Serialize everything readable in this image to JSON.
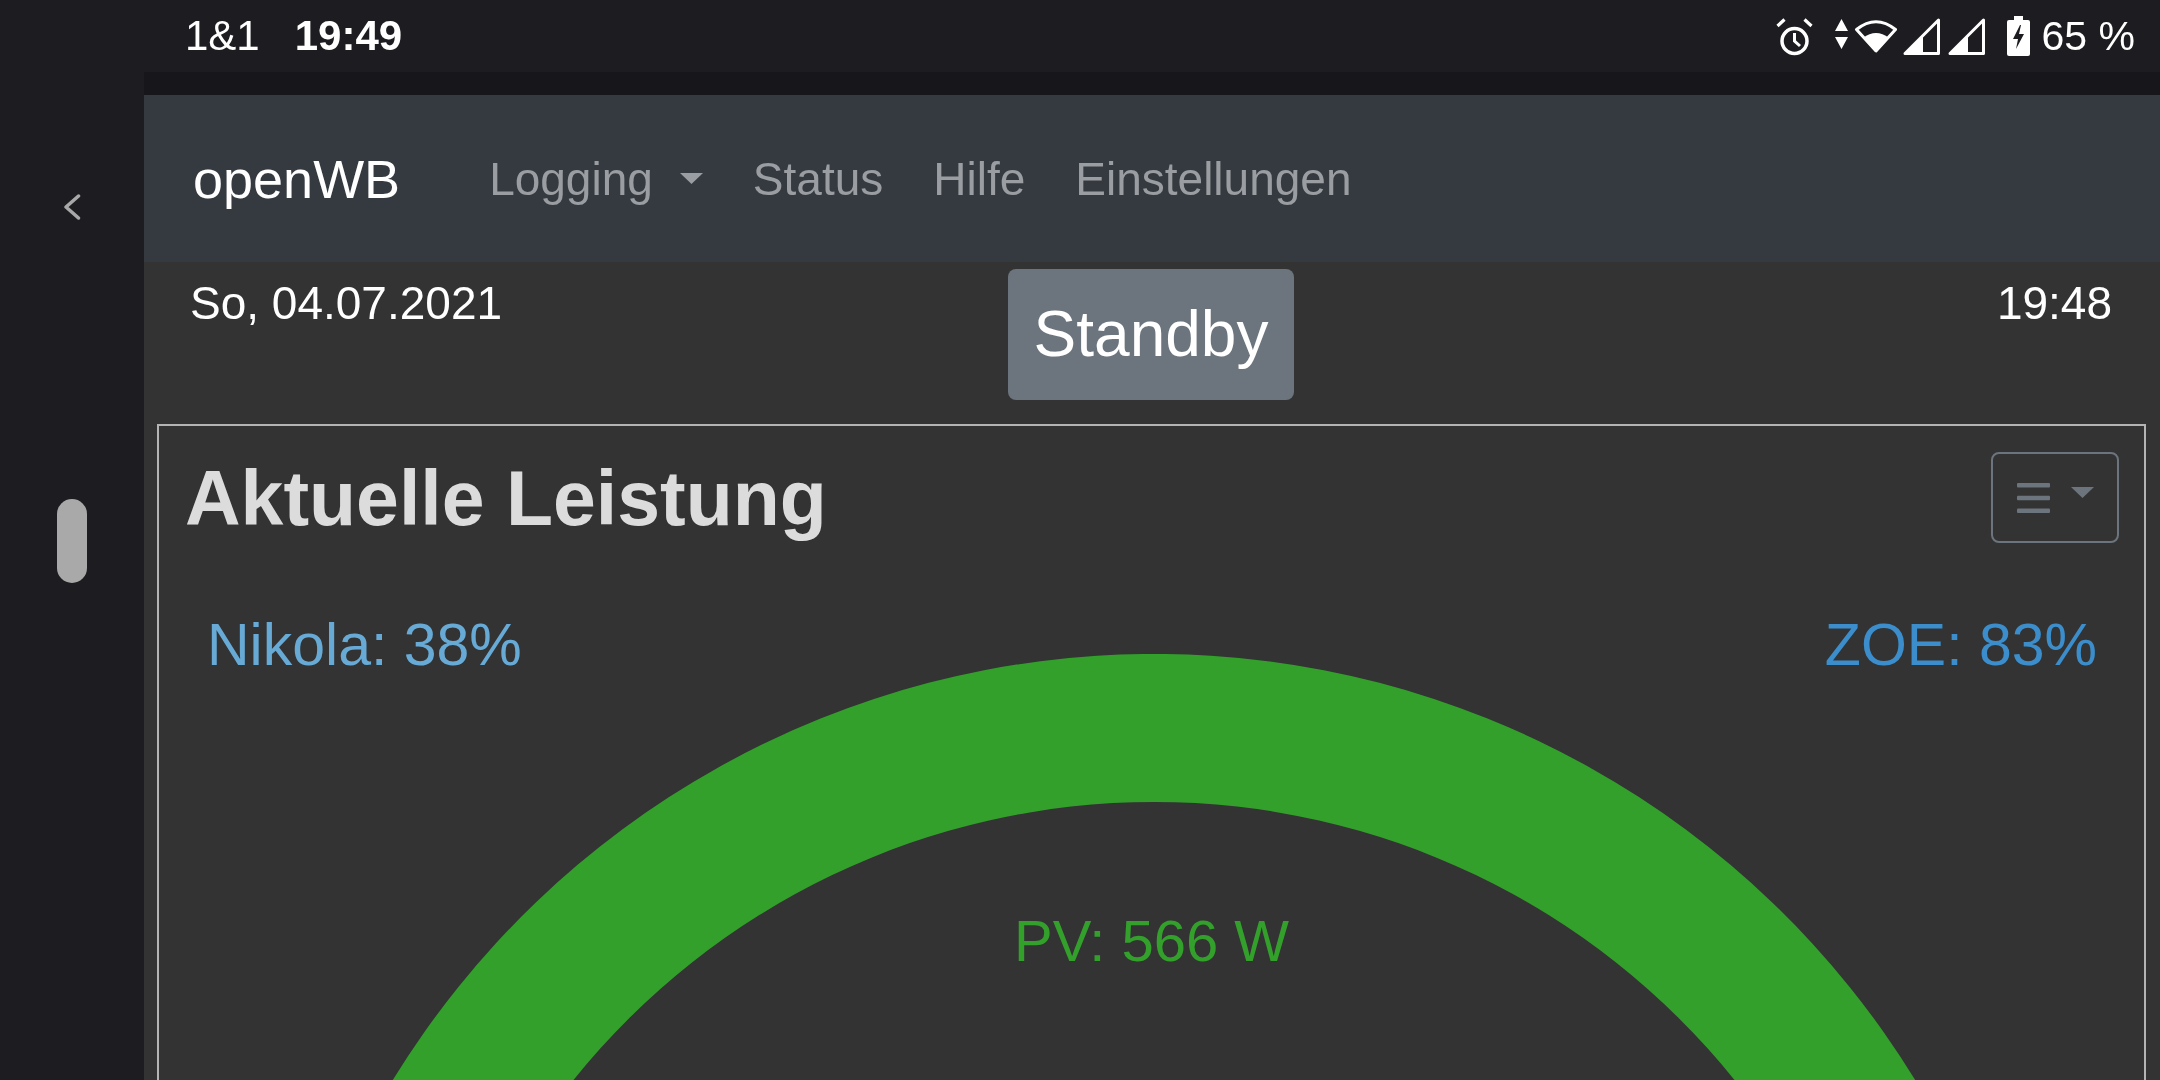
{
  "status_bar": {
    "carrier": "1&1",
    "time": "19:49",
    "battery": "65 %"
  },
  "navbar": {
    "brand": "openWB",
    "items": [
      {
        "label": "Logging",
        "kind": "dropdown"
      },
      {
        "label": "Status",
        "kind": "link"
      },
      {
        "label": "Hilfe",
        "kind": "link"
      },
      {
        "label": "Einstellungen",
        "kind": "link"
      }
    ]
  },
  "header": {
    "date": "So, 04.07.2021",
    "status": "Standby",
    "time": "19:48"
  },
  "card": {
    "title": "Aktuelle Leistung",
    "vehicles": [
      {
        "label": "Nikola: 38%",
        "color": "#68aad6"
      },
      {
        "label": "ZOE: 83%",
        "color": "#3b8ecb"
      }
    ],
    "center_label": "PV: 566 W"
  }
}
